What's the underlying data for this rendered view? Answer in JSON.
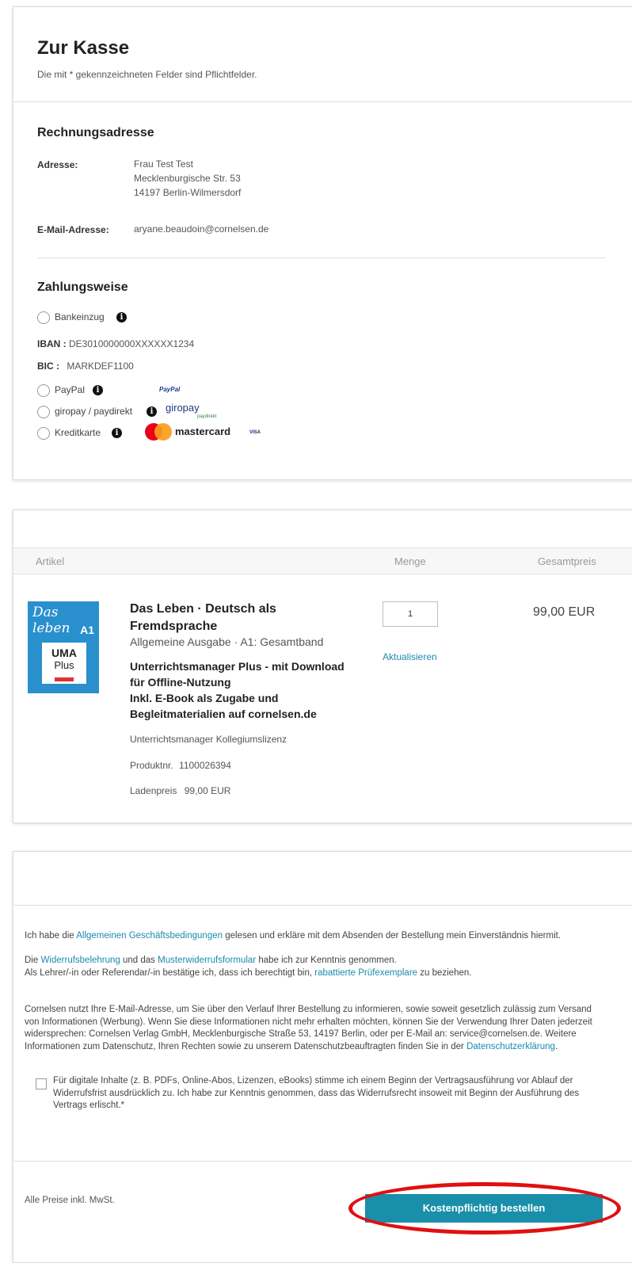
{
  "checkout": {
    "title": "Zur Kasse",
    "required_note": "Die mit * gekennzeichneten Felder sind Pflichtfelder."
  },
  "billing": {
    "heading": "Rechnungsadresse",
    "address_label": "Adresse:",
    "address_lines": [
      "Frau Test Test",
      "Mecklenburgische Str. 53",
      "14197 Berlin-Wilmersdorf"
    ],
    "email_label": "E-Mail-Adresse:",
    "email": "aryane.beaudoin@cornelsen.de"
  },
  "payment": {
    "heading": "Zahlungsweise",
    "options": [
      {
        "label": "Bankeinzug"
      },
      {
        "label": "PayPal",
        "logo": "PayPal"
      },
      {
        "label": "giropay / paydirekt",
        "logo": "giropay",
        "logo_sub": "paydirekt"
      },
      {
        "label": "Kreditkarte",
        "logo": "mastercard",
        "logo2": "VISA"
      }
    ],
    "iban_label": "IBAN :",
    "iban": "DE3010000000XXXXXX1234",
    "bic_label": "BIC :",
    "bic": "MARKDEF1100"
  },
  "cart": {
    "columns": {
      "article": "Artikel",
      "quantity": "Menge",
      "total": "Gesamtpreis"
    },
    "item": {
      "cover_title": "Das leben",
      "cover_level": "A1",
      "cover_badge_1": "UMA",
      "cover_badge_2": "Plus",
      "name_line1": "Das Leben · Deutsch als",
      "name_line2": "Fremdsprache",
      "edition": "Allgemeine Ausgabe · A1: Gesamtband",
      "desc_lines": [
        "Unterrichtsmanager Plus - mit Download",
        "für Offline-Nutzung",
        "Inkl. E-Book als Zugabe und",
        "Begleitmaterialien auf cornelsen.de"
      ],
      "license": "Unterrichtsmanager Kollegiumslizenz",
      "product_no_label": "Produktnr.",
      "product_no": "1100026394",
      "shop_price_label": "Ladenpreis",
      "shop_price": "99,00 EUR",
      "quantity": "1",
      "update_label": "Aktualisieren",
      "total": "99,00 EUR"
    }
  },
  "terms": {
    "p1_a": "Ich habe die ",
    "p1_link": "Allgemeinen Geschäftsbedingungen",
    "p1_b": " gelesen und erkläre mit dem Absenden der Bestellung mein Einverständnis hiermit.",
    "p2_a": "Die ",
    "p2_link1": "Widerrufsbelehrung",
    "p2_b": " und das ",
    "p2_link2": "Musterwiderrufsformular",
    "p2_c": " habe ich zur Kenntnis genommen.",
    "p3_a": "Als Lehrer/-in oder Referendar/-in bestätige ich, dass ich berechtigt bin, ",
    "p3_link": "rabattierte Prüfexemplare",
    "p3_b": " zu beziehen.",
    "privacy_a": "Cornelsen nutzt Ihre E-Mail-Adresse, um Sie über den Verlauf Ihrer Bestellung zu informieren, sowie soweit gesetzlich zulässig zum Versand von Informationen (Werbung). Wenn Sie diese Informationen nicht mehr erhalten möchten, können Sie der Verwendung Ihrer Daten jederzeit widersprechen: Cornelsen Verlag GmbH, Mecklenburgische Straße 53, 14197 Berlin, oder per E-Mail an: service@cornelsen.de. Weitere Informationen zum Datenschutz, Ihren Rechten sowie zu unserem Datenschutzbeauftragten finden Sie in der ",
    "privacy_link": "Datenschutzerklärung",
    "privacy_b": ".",
    "consent": "Für digitale Inhalte (z. B. PDFs, Online-Abos, Lizenzen, eBooks) stimme ich einem Beginn der Vertragsausführung vor Ablauf der Widerrufsfrist ausdrücklich zu. Ich habe zur Kenntnis genommen, dass das Widerrufsrecht insoweit mit Beginn der Ausführung des Vertrags erlischt.*",
    "vat_note": "Alle Preise inkl. MwSt.",
    "order_button": "Kostenpflichtig bestellen"
  },
  "colors": {
    "accent": "#1a8fa9",
    "link": "#1a8bb0",
    "highlight": "#e01010"
  }
}
